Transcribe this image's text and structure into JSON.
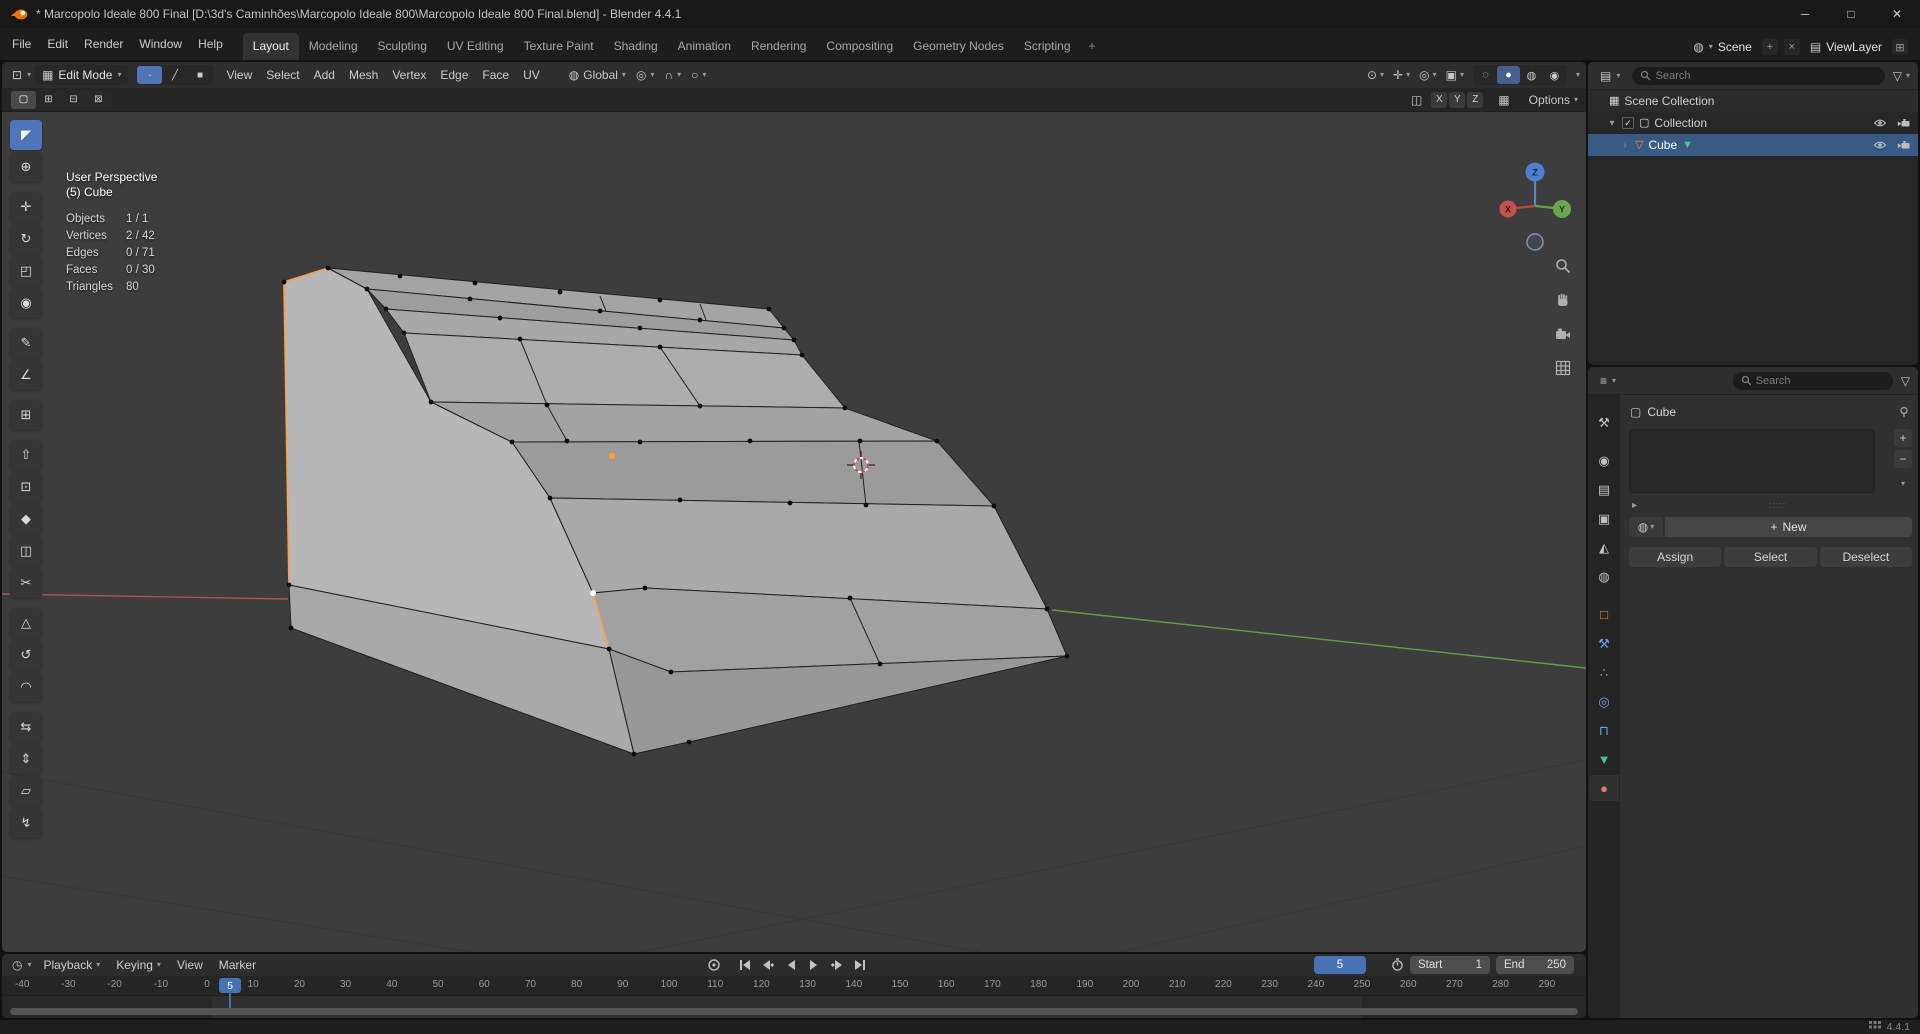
{
  "titlebar": {
    "title": "* Marcopolo Ideale 800 Final [D:\\3d's Caminhões\\Marcopolo Ideale 800\\Marcopolo Ideale 800 Final.blend] - Blender 4.4.1"
  },
  "icons": {
    "chevron_down": "▾",
    "magnet": "∩",
    "pivot": "◎",
    "proportional": "○",
    "orientation": "◍",
    "edit_mode": "▦",
    "viewport_editor": "⊡",
    "outliner_editor": "▤",
    "properties_editor": "≡",
    "timeline_editor": "◷",
    "mirror": "◫",
    "snap_target": "▦",
    "scene": "◍",
    "viewlayer": "▤",
    "cube": "▢",
    "browse_material": "◍",
    "filter_funnel": "▽",
    "add": "+",
    "minus": "−",
    "unlink": "×",
    "new_viewlayer": "⊞",
    "expand": "▸",
    "grip": ":::::",
    "window_min": "─",
    "window_max": "□",
    "window_close": "✕"
  },
  "topbar": {
    "menus": [
      "File",
      "Edit",
      "Render",
      "Window",
      "Help"
    ],
    "workspaces": [
      "Layout",
      "Modeling",
      "Sculpting",
      "UV Editing",
      "Texture Paint",
      "Shading",
      "Animation",
      "Rendering",
      "Compositing",
      "Geometry Nodes",
      "Scripting"
    ],
    "active_workspace": "Layout",
    "add_workspace_label": "+",
    "scene_selector": {
      "label": "Scene"
    },
    "viewlayer_selector": {
      "label": "ViewLayer"
    }
  },
  "viewport_header": {
    "mode_label": "Edit Mode",
    "menus": [
      "View",
      "Select",
      "Add",
      "Mesh",
      "Vertex",
      "Edge",
      "Face",
      "UV"
    ],
    "select_modes": [
      {
        "name": "vertex-select",
        "glyph": "∙",
        "active": true
      },
      {
        "name": "edge-select",
        "glyph": "╱",
        "active": false
      },
      {
        "name": "face-select",
        "glyph": "■",
        "active": false
      }
    ],
    "orientation_label": "Global",
    "view_toggles": [
      {
        "name": "show-visibility",
        "glyph": "⊙"
      },
      {
        "name": "show-gizmos",
        "glyph": "✛"
      },
      {
        "name": "show-overlays",
        "glyph": "◎"
      },
      {
        "name": "toggle-xray",
        "glyph": "▣"
      }
    ],
    "shading_modes": [
      {
        "name": "wireframe",
        "glyph": "◌",
        "active": false
      },
      {
        "name": "solid",
        "glyph": "●",
        "active": true
      },
      {
        "name": "material-preview",
        "glyph": "◍",
        "active": false
      },
      {
        "name": "rendered",
        "glyph": "◉",
        "active": false
      }
    ],
    "tool_option_modes": [
      {
        "name": "select-new",
        "glyph": "▢"
      },
      {
        "name": "select-extend",
        "glyph": "⊞"
      },
      {
        "name": "select-subtract",
        "glyph": "⊟"
      },
      {
        "name": "select-intersect",
        "glyph": "⊠"
      }
    ],
    "mirror_axes": [
      "X",
      "Y",
      "Z"
    ],
    "options_label": "Options"
  },
  "viewport_overlay": {
    "view_label": "User Perspective",
    "object_label": "(5) Cube",
    "stats": [
      {
        "label": "Objects",
        "value": "1 / 1"
      },
      {
        "label": "Vertices",
        "value": "2 / 42"
      },
      {
        "label": "Edges",
        "value": "0 / 71"
      },
      {
        "label": "Faces",
        "value": "0 / 30"
      },
      {
        "label": "Triangles",
        "value": "80"
      }
    ],
    "gizmo_axis_labels": {
      "x": "X",
      "y": "Y",
      "z": "Z"
    }
  },
  "toolbar_tools": [
    {
      "name": "select-box",
      "glyph": "◤",
      "active": true
    },
    {
      "name": "cursor",
      "glyph": "⊕"
    },
    {
      "name": "move",
      "glyph": "✛",
      "group": true
    },
    {
      "name": "rotate",
      "glyph": "↻"
    },
    {
      "name": "scale",
      "glyph": "◰"
    },
    {
      "name": "transform",
      "glyph": "◉"
    },
    {
      "name": "annotate",
      "glyph": "✎",
      "group": true
    },
    {
      "name": "measure",
      "glyph": "∠"
    },
    {
      "name": "add-cube",
      "glyph": "⊞",
      "group": true
    },
    {
      "name": "extrude-region",
      "glyph": "⇧",
      "group": true
    },
    {
      "name": "inset-faces",
      "glyph": "⊡"
    },
    {
      "name": "bevel",
      "glyph": "◆"
    },
    {
      "name": "loop-cut",
      "glyph": "◫"
    },
    {
      "name": "knife",
      "glyph": "✂"
    },
    {
      "name": "poly-build",
      "glyph": "△",
      "group": true
    },
    {
      "name": "spin",
      "glyph": "↺"
    },
    {
      "name": "smooth",
      "glyph": "◠"
    },
    {
      "name": "edge-slide",
      "glyph": "⇆",
      "group": true
    },
    {
      "name": "shrink-fatten",
      "glyph": "⇕"
    },
    {
      "name": "shear",
      "glyph": "▱"
    },
    {
      "name": "rip-region",
      "glyph": "↯"
    }
  ],
  "outliner": {
    "search_placeholder": "Search",
    "rows": [
      {
        "label": "Scene Collection",
        "icon_name": "scene-collection",
        "icon_glyph": "▦",
        "icon_color": "#d8d8d8",
        "depth": 0,
        "expander": "",
        "selected": false,
        "show_checkbox": false,
        "show_visibility": false
      },
      {
        "label": "Collection",
        "icon_name": "collection",
        "icon_glyph": "▢",
        "icon_color": "#d8d8d8",
        "depth": 1,
        "expander": "▾",
        "selected": false,
        "show_checkbox": true,
        "show_visibility": true
      },
      {
        "label": "Cube",
        "icon_name": "mesh-object",
        "icon_glyph": "▽",
        "icon_color": "#e8923c",
        "depth": 2,
        "expander": "›",
        "selected": true,
        "show_checkbox": false,
        "show_visibility": true,
        "data_icon": "▼",
        "data_icon_color": "#57c28f"
      }
    ]
  },
  "properties": {
    "search_placeholder": "Search",
    "breadcrumb_label": "Cube",
    "new_button_label": "New",
    "assign_label": "Assign",
    "select_label": "Select",
    "deselect_label": "Deselect",
    "tabs": [
      {
        "name": "tool",
        "glyph": "⚒",
        "color": "#c0c0c0",
        "active": false
      },
      {
        "name": "render",
        "glyph": "◉",
        "color": "#c0c0c0",
        "active": false,
        "gap": true
      },
      {
        "name": "output",
        "glyph": "▤",
        "color": "#c0c0c0",
        "active": false
      },
      {
        "name": "view-layer",
        "glyph": "▣",
        "color": "#c0c0c0",
        "active": false
      },
      {
        "name": "scene",
        "glyph": "◭",
        "color": "#c0c0c0",
        "active": false
      },
      {
        "name": "world",
        "glyph": "◍",
        "color": "#c0c0c0",
        "active": false
      },
      {
        "name": "object",
        "glyph": "□",
        "color": "#e8923c",
        "active": false,
        "gap": true
      },
      {
        "name": "modifiers",
        "glyph": "⚒",
        "color": "#6ba6e8",
        "active": false
      },
      {
        "name": "particles",
        "glyph": "∴",
        "color": "#6ba6e8",
        "active": false
      },
      {
        "name": "physics",
        "glyph": "◎",
        "color": "#6ba6e8",
        "active": false
      },
      {
        "name": "constraints",
        "glyph": "⊓",
        "color": "#6ba6e8",
        "active": false
      },
      {
        "name": "object-data",
        "glyph": "▼",
        "color": "#55bb88",
        "active": false
      },
      {
        "name": "material",
        "glyph": "●",
        "color": "#e07a7a",
        "active": true
      }
    ]
  },
  "timeline": {
    "menus": [
      {
        "label": "Playback",
        "caret": true
      },
      {
        "label": "Keying",
        "caret": true
      },
      {
        "label": "View",
        "caret": false
      },
      {
        "label": "Marker",
        "caret": false
      }
    ],
    "current_frame": "5",
    "start_label": "Start",
    "start_value": "1",
    "end_label": "End",
    "end_value": "250",
    "ruler_labels": [
      "-40",
      "-30",
      "-20",
      "-10",
      "0",
      "10",
      "20",
      "30",
      "40",
      "50",
      "60",
      "70",
      "80",
      "90",
      "100",
      "110",
      "120",
      "130",
      "140",
      "150",
      "160",
      "170",
      "180",
      "190",
      "200",
      "210",
      "220",
      "230",
      "240",
      "250",
      "260",
      "270",
      "280",
      "290"
    ]
  },
  "statusbar": {
    "version_label": "4.4.1"
  }
}
